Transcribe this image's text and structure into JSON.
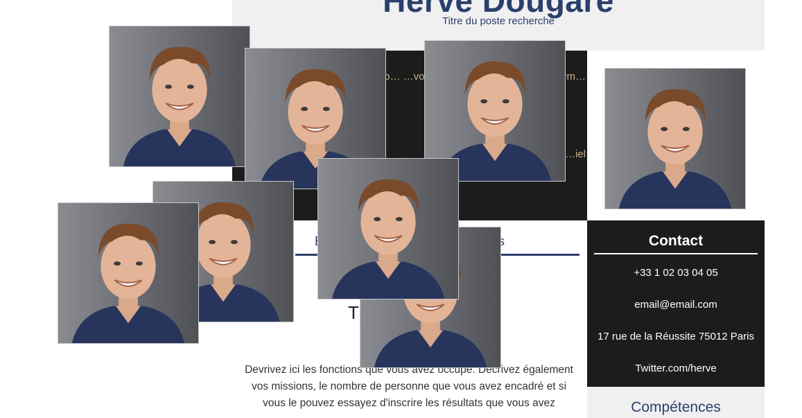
{
  "header": {
    "name": "Hervé Dougare",
    "subtitle": "Titre du poste recherché"
  },
  "profile": {
    "line1": "…os comp… …vos …ez les m… …ces …ous form…",
    "line2": "…début d'… …iel"
  },
  "experience": {
    "tab_left": "E",
    "tab_right": "s",
    "title_fragment": "T",
    "body": "Devrivez ici les fonctions que vous avez occupé. Decrivez également vos missions, le nombre de personne que vous avez encadré et si vous le pouvez essayez d'inscrire les résultats que vous avez"
  },
  "contact": {
    "title": "Contact",
    "phone": "+33 1 02 03 04 05",
    "email": "email@email.com",
    "address": "17 rue de la Réussite 75012 Paris",
    "twitter": "Twitter.com/herve"
  },
  "skills": {
    "title": "Compétences"
  },
  "colors": {
    "accent": "#2b3f6b",
    "dark": "#1c1c1c",
    "profile_text": "#c8b48a",
    "light_band": "#f0f0f1"
  }
}
